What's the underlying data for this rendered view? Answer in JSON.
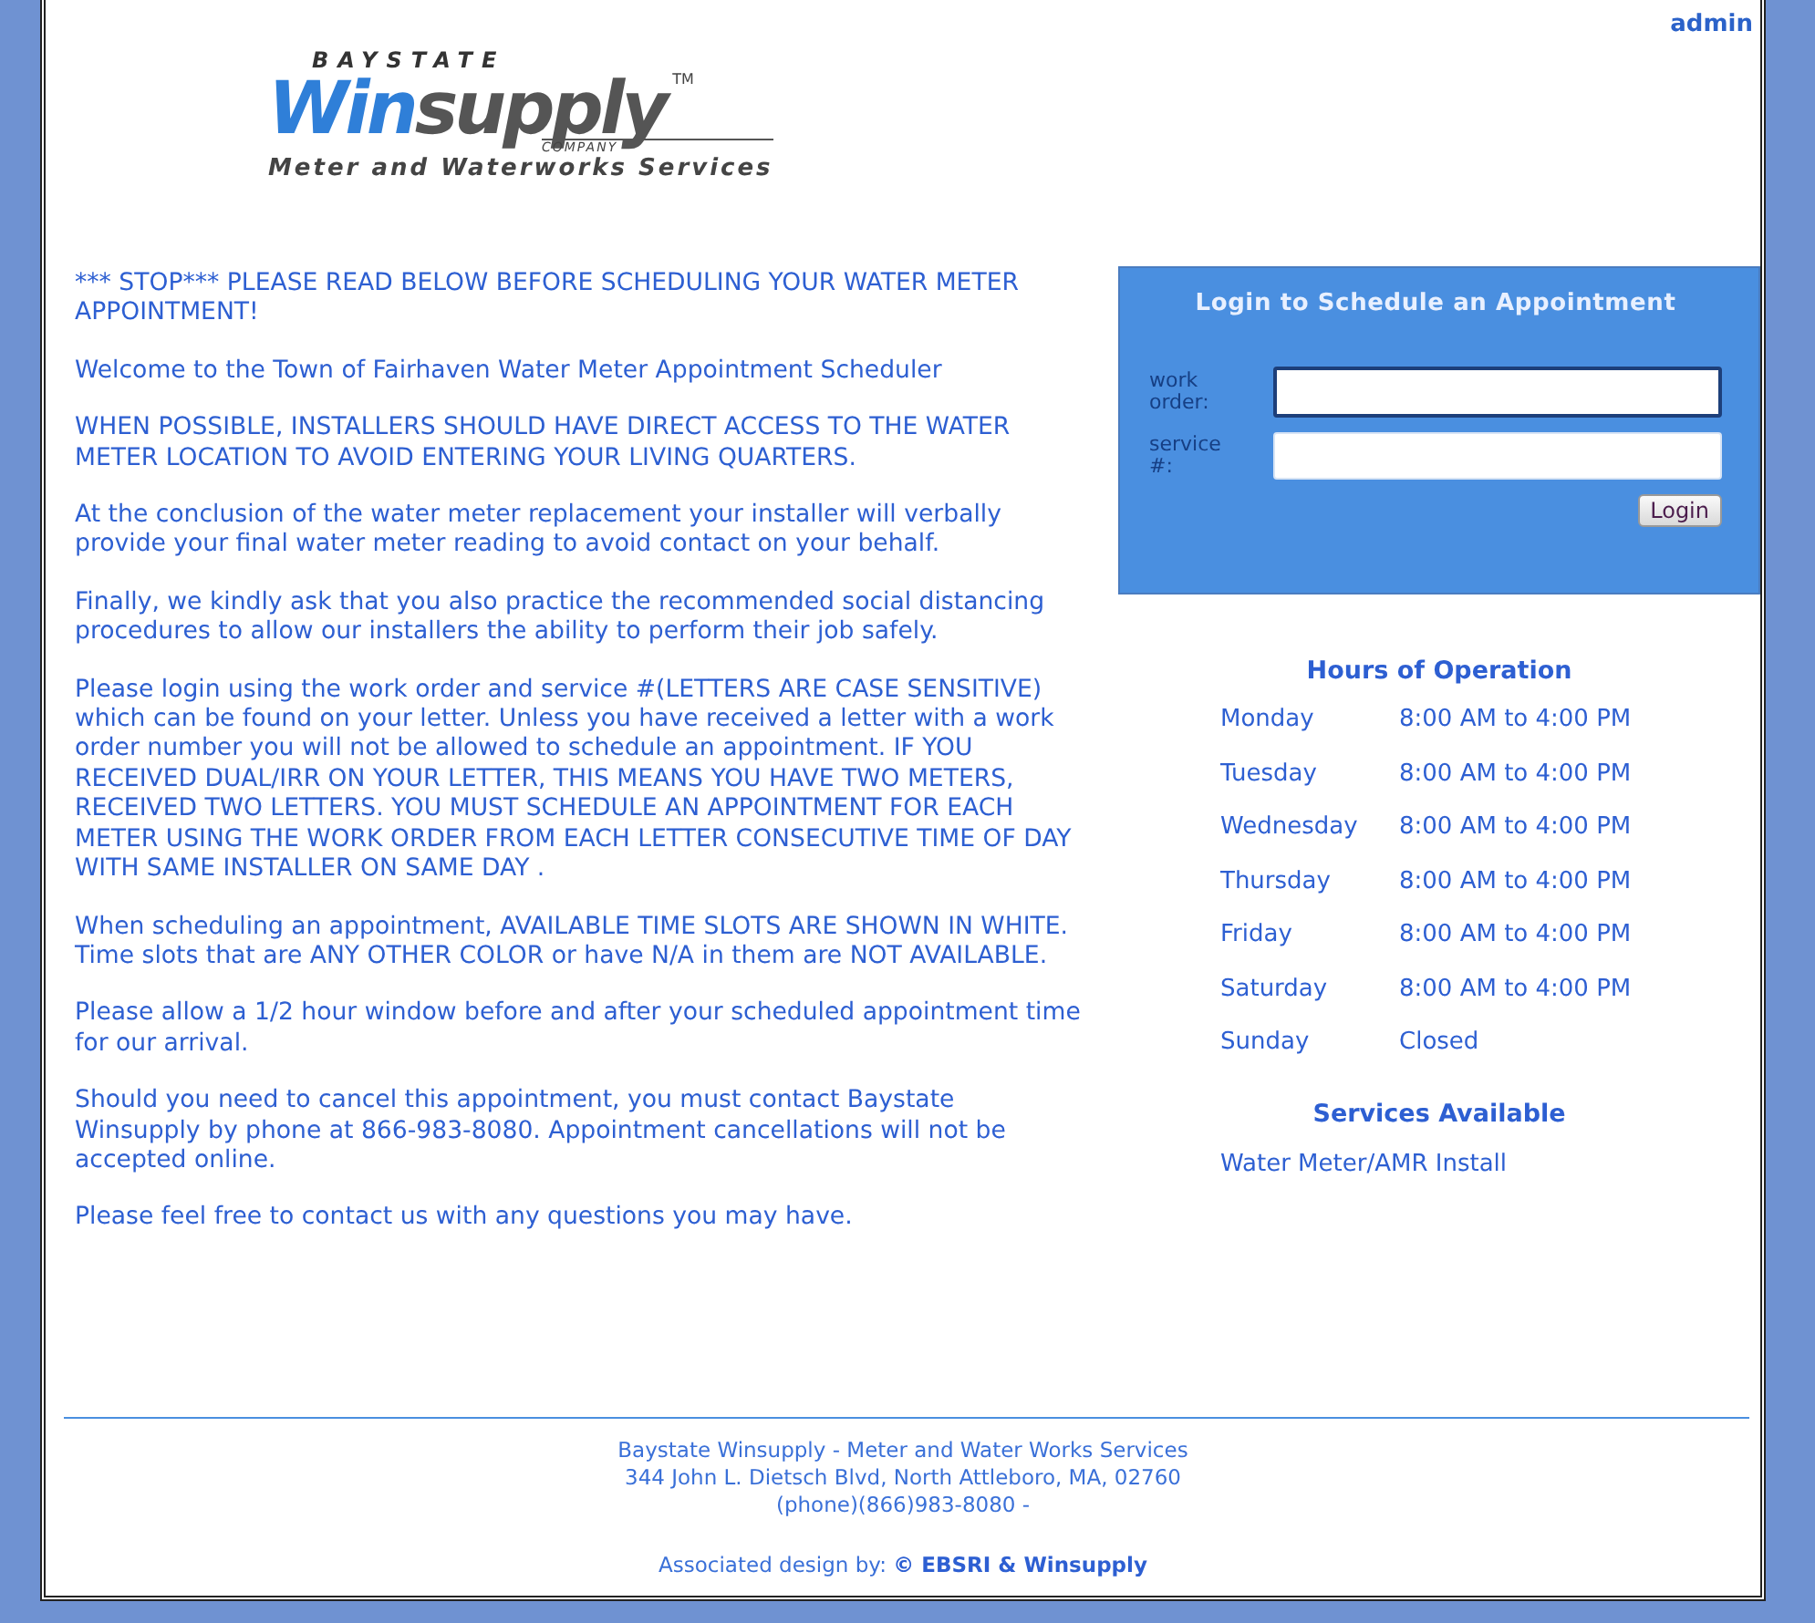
{
  "header": {
    "admin_link": "admin"
  },
  "logo": {
    "top": "BAYSTATE",
    "brand_blue": "Win",
    "brand_grey": "supply",
    "trademark": "TM",
    "company": "COMPANY",
    "tagline": "Meter and Waterworks Services"
  },
  "notice": [
    "*** STOP*** PLEASE READ BELOW BEFORE SCHEDULING YOUR WATER METER APPOINTMENT!",
    "Welcome to the Town of Fairhaven Water Meter Appointment Scheduler",
    "WHEN POSSIBLE, INSTALLERS SHOULD HAVE DIRECT ACCESS TO THE WATER METER LOCATION TO AVOID ENTERING YOUR LIVING QUARTERS.",
    "At the conclusion of the water meter replacement your installer will verbally provide your final water meter reading to avoid contact on your behalf.",
    "Finally, we kindly ask that you also practice the recommended social distancing procedures to allow our installers the ability to perform their job safely.",
    "Please login using the work order and service #(LETTERS ARE CASE SENSITIVE) which can be found on your letter. Unless you have received a letter with a work order number you will not be allowed to schedule an appointment. IF YOU RECEIVED DUAL/IRR ON YOUR LETTER, THIS MEANS YOU HAVE TWO METERS, RECEIVED TWO LETTERS. YOU MUST SCHEDULE AN APPOINTMENT FOR EACH METER USING THE WORK ORDER FROM EACH LETTER CONSECUTIVE TIME OF DAY WITH SAME INSTALLER ON SAME DAY .",
    "When scheduling an appointment, AVAILABLE TIME SLOTS ARE SHOWN IN WHITE. Time slots that are ANY OTHER COLOR or have N/A in them are NOT AVAILABLE.",
    "Please allow a 1/2 hour window before and after your scheduled appointment time for our arrival.",
    "Should you need to cancel this appointment, you must contact Baystate Winsupply by phone at 866-983-8080. Appointment cancellations will not be accepted online.",
    "Please feel free to contact us with any questions you may have."
  ],
  "login": {
    "title": "Login to Schedule an Appointment",
    "fields": [
      {
        "label": "work order:",
        "focused": true
      },
      {
        "label": "service #:",
        "focused": false
      }
    ],
    "button": "Login"
  },
  "hours": {
    "title": "Hours of Operation",
    "rows": [
      {
        "day": "Monday",
        "time": "8:00 AM to 4:00 PM"
      },
      {
        "day": "Tuesday",
        "time": "8:00 AM to 4:00 PM"
      },
      {
        "day": "Wednesday",
        "time": "8:00 AM to 4:00 PM"
      },
      {
        "day": "Thursday",
        "time": "8:00 AM to 4:00 PM"
      },
      {
        "day": "Friday",
        "time": "8:00 AM to 4:00 PM"
      },
      {
        "day": "Saturday",
        "time": "8:00 AM to 4:00 PM"
      },
      {
        "day": "Sunday",
        "time": "Closed"
      }
    ]
  },
  "services": {
    "title": "Services Available",
    "items": [
      "Water Meter/AMR Install"
    ]
  },
  "footer": {
    "lines": [
      "Baystate Winsupply - Meter and Water Works Services",
      "344 John L. Dietsch Blvd, North Attleboro, MA, 02760",
      "(phone)(866)983-8080 -"
    ],
    "credit_prefix": "Associated design by:",
    "credit_strong": "© EBSRI & Winsupply"
  }
}
